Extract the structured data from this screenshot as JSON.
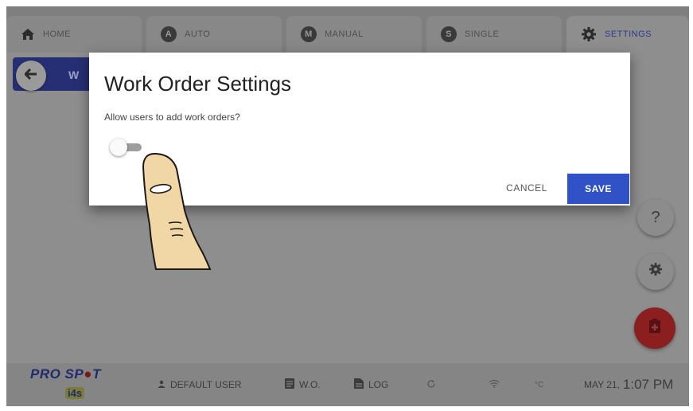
{
  "tabs": [
    {
      "label": "HOME",
      "icon": "home-icon",
      "badge": ""
    },
    {
      "label": "AUTO",
      "icon": "auto-badge",
      "badge": "A"
    },
    {
      "label": "MANUAL",
      "icon": "manual-badge",
      "badge": "M"
    },
    {
      "label": "SINGLE",
      "icon": "single-badge",
      "badge": "S"
    },
    {
      "label": "SETTINGS",
      "icon": "gear-icon",
      "badge": "",
      "active": true
    }
  ],
  "page": {
    "title_fragment": "W"
  },
  "modal": {
    "title": "Work Order Settings",
    "question": "Allow users to add work orders?",
    "toggle_on": false,
    "cancel_label": "CANCEL",
    "save_label": "SAVE"
  },
  "fabs": {
    "help_label": "?"
  },
  "bottom_bar": {
    "brand_top": "PRO SP",
    "brand_dot": "●",
    "brand_t": "T",
    "brand_sub": "i4s",
    "user_label": "DEFAULT USER",
    "wo_label": "W.O.",
    "log_label": "LOG",
    "temp_unit": "°C",
    "date": "MAY 21,",
    "time": "1:07 PM"
  },
  "colors": {
    "accent": "#3151c6",
    "header_strip": "#262f73",
    "add_fab": "#8b1f1f"
  }
}
